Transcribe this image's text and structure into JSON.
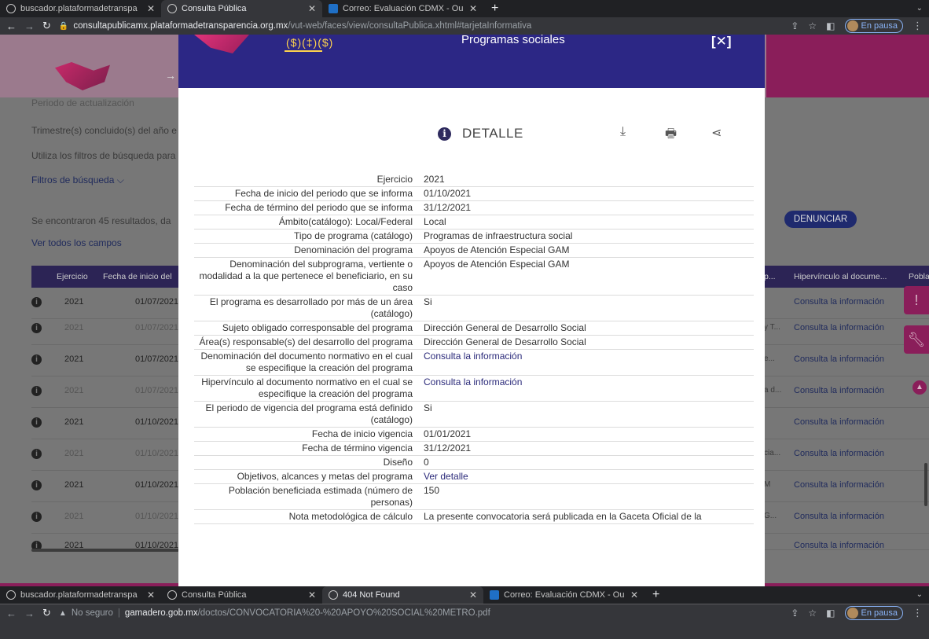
{
  "browser_top": {
    "tabs": [
      {
        "title": "buscador.plataformadetranspa",
        "active": false,
        "favicon": "globe-icon"
      },
      {
        "title": "Consulta Pública",
        "active": true,
        "favicon": "globe-icon"
      },
      {
        "title": "Correo: Evaluación CDMX - Ou",
        "active": false,
        "favicon": "outlook-icon"
      }
    ],
    "url_host": "consultapublicamx.plataformadetransparencia.org.mx",
    "url_path": "/vut-web/faces/view/consultaPublica.xhtml#tarjetaInformativa",
    "profile_label": "En pausa"
  },
  "browser_bottom": {
    "tabs": [
      {
        "title": "buscador.plataformadetranspa",
        "active": false,
        "favicon": "globe-icon"
      },
      {
        "title": "Consulta Pública",
        "active": false,
        "favicon": "globe-icon"
      },
      {
        "title": "404 Not Found",
        "active": true,
        "favicon": "globe-icon"
      },
      {
        "title": "Correo: Evaluación CDMX - Ou",
        "active": false,
        "favicon": "outlook-icon"
      }
    ],
    "security_label": "No seguro",
    "url_host": "gamadero.gob.mx",
    "url_path": "/doctos/CONVOCATORIA%20-%20APOYO%20SOCIAL%20METRO.pdf",
    "profile_label": "En pausa"
  },
  "background_page": {
    "periodo_label": "Periodo de actualización",
    "trimestre_text": "Trimestre(s) concluido(s) del año e",
    "filtros_hint": "Utiliza los filtros de búsqueda para",
    "filtros_link": "Filtros de búsqueda",
    "results_text": "Se encontraron 45 resultados, da",
    "ver_campos": "Ver todos los campos",
    "denunciar": "DENUNCIAR",
    "table_headers": {
      "ejercicio": "Ejercicio",
      "fecha_inicio": "Fecha de inicio del",
      "col_p": "p...",
      "hipervinculo": "Hipervínculo al docume...",
      "pobla": "Pobla"
    },
    "rows": [
      {
        "year": "2021",
        "date": "01/07/2021",
        "trunc": "",
        "link": "Consulta la información"
      },
      {
        "year": "2021",
        "date": "01/07/2021",
        "trunc": "y T...",
        "link": "Consulta la información"
      },
      {
        "year": "2021",
        "date": "01/07/2021",
        "trunc": "e...",
        "link": "Consulta la información"
      },
      {
        "year": "2021",
        "date": "01/07/2021",
        "trunc": "a d...",
        "link": "Consulta la información"
      },
      {
        "year": "2021",
        "date": "01/10/2021",
        "trunc": "",
        "link": "Consulta la información"
      },
      {
        "year": "2021",
        "date": "01/10/2021",
        "trunc": "cia...",
        "link": "Consulta la información"
      },
      {
        "year": "2021",
        "date": "01/10/2021",
        "trunc": "M",
        "link": "Consulta la información"
      },
      {
        "year": "2021",
        "date": "01/10/2021",
        "trunc": "G...",
        "link": "Consulta la información"
      },
      {
        "year": "2021",
        "date": "01/10/2021",
        "trunc": "",
        "link": "Consulta la información"
      }
    ]
  },
  "modal": {
    "header_title": "Programas sociales",
    "detail_title": "DETALLE",
    "fields": [
      {
        "label": "Ejercicio",
        "value": "2021",
        "link": false
      },
      {
        "label": "Fecha de inicio del periodo que se informa",
        "value": "01/10/2021",
        "link": false
      },
      {
        "label": "Fecha de término del periodo que se informa",
        "value": "31/12/2021",
        "link": false
      },
      {
        "label": "Ámbito(catálogo): Local/Federal",
        "value": "Local",
        "link": false
      },
      {
        "label": "Tipo de programa (catálogo)",
        "value": "Programas de infraestructura social",
        "link": false
      },
      {
        "label": "Denominación del programa",
        "value": "Apoyos de Atención Especial GAM",
        "link": false
      },
      {
        "label": "Denominación del subprograma, vertiente o modalidad a la que pertenece el beneficiario, en su caso",
        "value": "Apoyos de Atención Especial GAM",
        "link": false
      },
      {
        "label": "El programa es desarrollado por más de un área (catálogo)",
        "value": "Si",
        "link": false
      },
      {
        "label": "Sujeto obligado corresponsable del programa",
        "value": "Dirección General de Desarrollo Social",
        "link": false
      },
      {
        "label": "Área(s) responsable(s) del desarrollo del programa",
        "value": "Dirección General de Desarrollo Social",
        "link": false
      },
      {
        "label": "Denominación del documento normativo en el cual se especifique la creación del programa",
        "value": "Consulta la información",
        "link": true
      },
      {
        "label": "Hipervínculo al documento normativo en el cual se especifique la creación del programa",
        "value": "Consulta la información",
        "link": true
      },
      {
        "label": "El periodo de vigencia del programa está definido (catálogo)",
        "value": "Si",
        "link": false
      },
      {
        "label": "Fecha de inicio vigencia",
        "value": "01/01/2021",
        "link": false
      },
      {
        "label": "Fecha de término vigencia",
        "value": "31/12/2021",
        "link": false
      },
      {
        "label": "Diseño",
        "value": "0",
        "link": false
      },
      {
        "label": "Objetivos, alcances y metas del programa",
        "value": "Ver detalle",
        "link": true
      },
      {
        "label": "Población beneficiada estimada (número de personas)",
        "value": "150",
        "link": false
      },
      {
        "label": "Nota metodológica de cálculo",
        "value": "La presente convocatoria será publicada en la Gaceta Oficial de la",
        "link": false
      }
    ]
  }
}
